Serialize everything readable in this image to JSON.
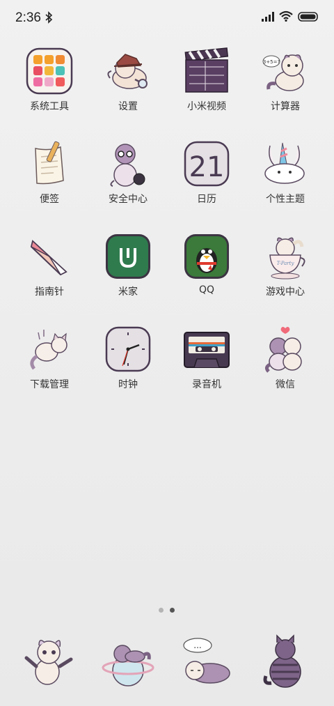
{
  "status": {
    "time": "2:36",
    "icons": [
      "bluetooth-icon",
      "cellular-signal-icon",
      "wifi-icon",
      "battery-icon"
    ]
  },
  "apps": [
    {
      "label": "系统工具",
      "icon": "system-tools-folder-icon"
    },
    {
      "label": "设置",
      "icon": "detective-cat-icon"
    },
    {
      "label": "小米视频",
      "icon": "clapperboard-icon"
    },
    {
      "label": "计算器",
      "icon": "calculator-cat-icon"
    },
    {
      "label": "便签",
      "icon": "notepad-pencil-icon"
    },
    {
      "label": "安全中心",
      "icon": "security-cat-icon"
    },
    {
      "label": "日历",
      "icon": "calendar-icon",
      "date": "21"
    },
    {
      "label": "个性主题",
      "icon": "unicorn-bunny-icon"
    },
    {
      "label": "指南针",
      "icon": "compass-needle-icon"
    },
    {
      "label": "米家",
      "icon": "mijia-icon"
    },
    {
      "label": "QQ",
      "icon": "qq-penguin-icon"
    },
    {
      "label": "游戏中心",
      "icon": "teacup-cat-icon",
      "cup_text": "T-Party"
    },
    {
      "label": "下载管理",
      "icon": "falling-cat-icon"
    },
    {
      "label": "时钟",
      "icon": "clock-icon"
    },
    {
      "label": "录音机",
      "icon": "cassette-tape-icon"
    },
    {
      "label": "微信",
      "icon": "hugging-cats-icon"
    }
  ],
  "dock": [
    {
      "icon": "waving-cat-icon"
    },
    {
      "icon": "planet-cat-icon"
    },
    {
      "icon": "sleeping-cat-icon",
      "bubble": "..."
    },
    {
      "icon": "cat-back-icon"
    }
  ],
  "calculator_bubble": "3+5=?",
  "page_indicator": {
    "count": 2,
    "active": 2
  },
  "colors": {
    "background": "#ececec",
    "label": "#333333",
    "mijia_green": "#2f7b4e",
    "qq_green": "#3b7a3a",
    "cat_purple": "#6c5578"
  }
}
